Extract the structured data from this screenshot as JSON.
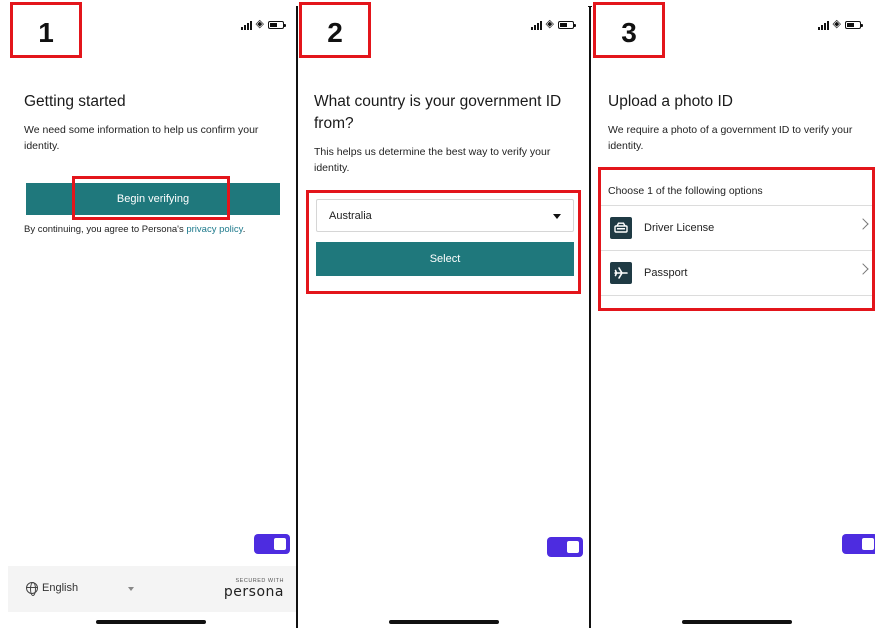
{
  "steps": [
    {
      "number": "1"
    },
    {
      "number": "2"
    },
    {
      "number": "3"
    }
  ],
  "screen1": {
    "title": "Getting started",
    "description": "We need some information to help us confirm your identity.",
    "begin_button": "Begin verifying",
    "consent_prefix": "By continuing, you agree to Persona's ",
    "consent_link": "privacy policy",
    "consent_suffix": ".",
    "footer": {
      "language": "English",
      "secured_with": "SECURED WITH",
      "brand": "persona"
    }
  },
  "screen2": {
    "title": "What country is your government ID from?",
    "description": "This helps us determine the best way to verify your identity.",
    "country_selected": "Australia",
    "select_button": "Select"
  },
  "screen3": {
    "title": "Upload a photo ID",
    "description": "We require a photo of a government ID to verify your identity.",
    "options_heading": "Choose 1 of the following options",
    "options": [
      {
        "label": "Driver License",
        "icon": "car-icon"
      },
      {
        "label": "Passport",
        "icon": "airplane-icon"
      }
    ]
  },
  "colors": {
    "primary_button": "#1f787c",
    "highlight_red": "#e3151b",
    "toggle_purple": "#4d2ce0",
    "link": "#1e7a8c"
  }
}
